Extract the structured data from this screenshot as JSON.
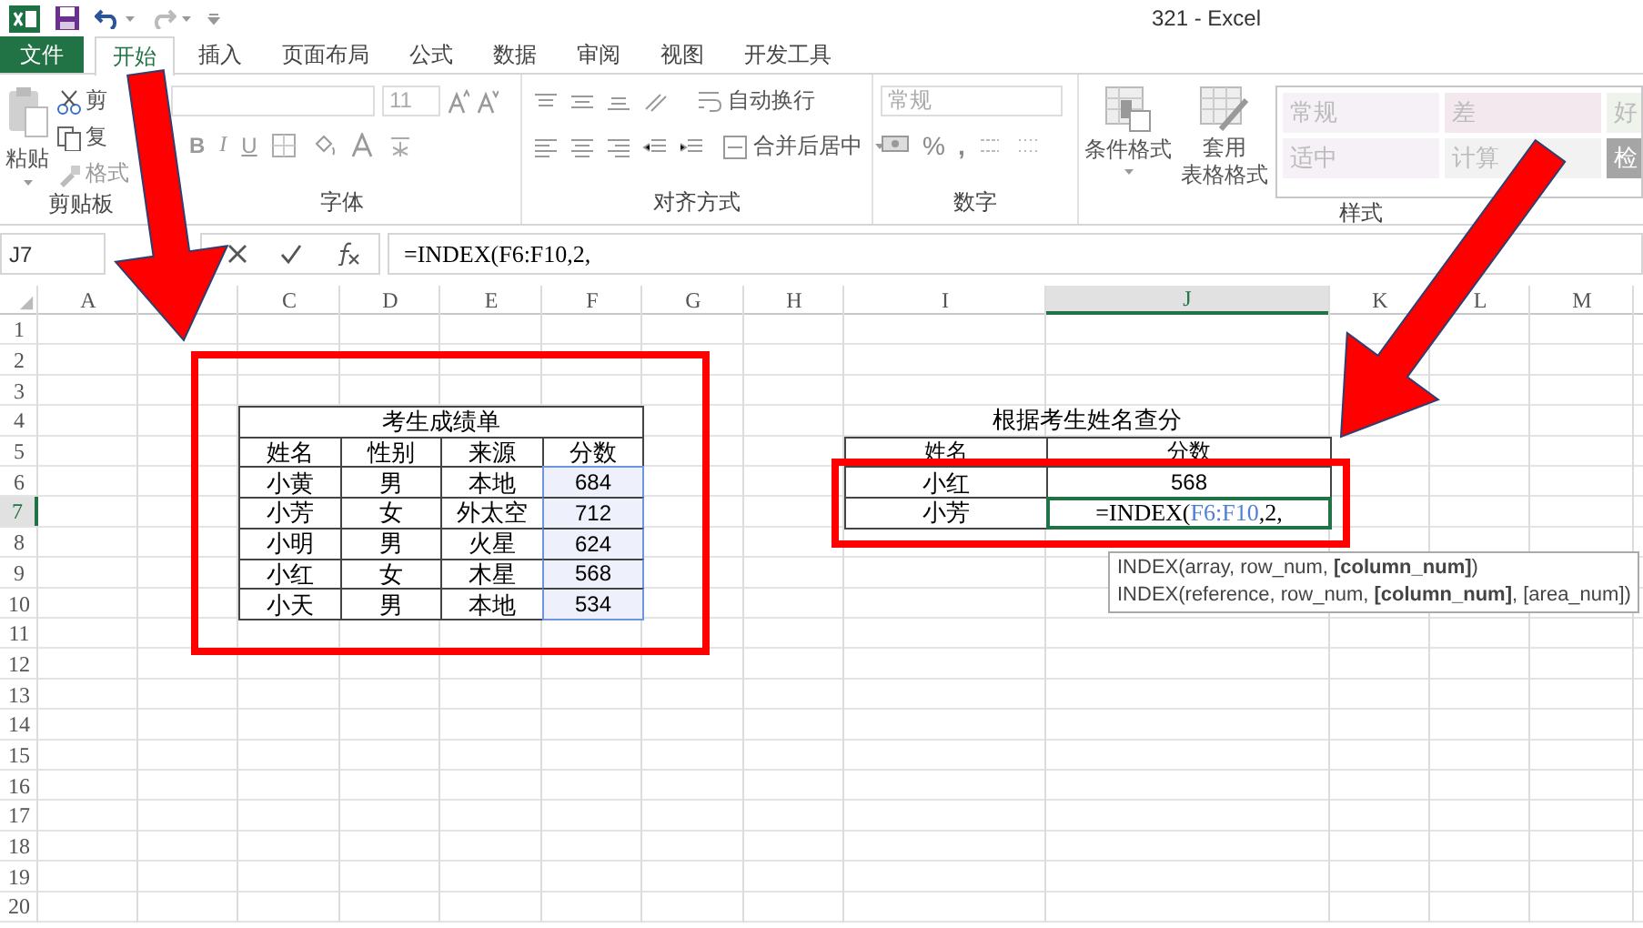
{
  "title_bar": {
    "title": "321 - Excel"
  },
  "tabs": [
    {
      "label": "文件",
      "kind": "file",
      "selected": false
    },
    {
      "label": "开始",
      "kind": "tab",
      "selected": true
    },
    {
      "label": "插入",
      "kind": "tab",
      "selected": false
    },
    {
      "label": "页面布局",
      "kind": "tab",
      "selected": false
    },
    {
      "label": "公式",
      "kind": "tab",
      "selected": false
    },
    {
      "label": "数据",
      "kind": "tab",
      "selected": false
    },
    {
      "label": "审阅",
      "kind": "tab",
      "selected": false
    },
    {
      "label": "视图",
      "kind": "tab",
      "selected": false
    },
    {
      "label": "开发工具",
      "kind": "tab",
      "selected": false
    }
  ],
  "ribbon": {
    "groups": [
      {
        "kind": "clipboard",
        "label": "剪贴板",
        "paste": "粘贴",
        "cut": "剪",
        "copy": "复",
        "format_painter": "格式"
      },
      {
        "kind": "font",
        "label": "字体",
        "font_size": "11",
        "bold": "B",
        "italic": "I",
        "underline": "U"
      },
      {
        "kind": "alignment",
        "label": "对齐方式",
        "wrap_text": "自动换行",
        "merge_center": "合并后居中"
      },
      {
        "kind": "number",
        "label": "数字",
        "format": "常规",
        "percent": "%",
        "comma": ","
      },
      {
        "kind": "styles",
        "label": "样式",
        "conditional": "条件格式",
        "format_table": [
          "套用",
          "表格格式"
        ],
        "cell_styles": [
          {
            "label": "常规",
            "color": "#f6f1f6"
          },
          {
            "label": "差",
            "color": "#f2e8ee"
          },
          {
            "label": "好",
            "color": "#eef3ec"
          },
          {
            "label": "适中",
            "color": "#f6f1f6"
          },
          {
            "label": "计算",
            "color": "#f2f2f2"
          },
          {
            "label": "检",
            "color": "#a5a5a5"
          }
        ]
      }
    ]
  },
  "formula_bar": {
    "name_box": "J7",
    "formula": "=INDEX(F6:F10,2,"
  },
  "sheet": {
    "columns": [
      {
        "label": "A",
        "selected": false
      },
      {
        "label": "C",
        "selected": false
      },
      {
        "label": "D",
        "selected": false
      },
      {
        "label": "E",
        "selected": false
      },
      {
        "label": "F",
        "selected": false
      },
      {
        "label": "G",
        "selected": false
      },
      {
        "label": "H",
        "selected": false
      },
      {
        "label": "I",
        "selected": false
      },
      {
        "label": "J",
        "selected": true
      },
      {
        "label": "K",
        "selected": false
      },
      {
        "label": "L",
        "selected": false
      },
      {
        "label": "M",
        "selected": false
      }
    ],
    "rows": [
      {
        "label": "1",
        "selected": false
      },
      {
        "label": "2",
        "selected": false
      },
      {
        "label": "3",
        "selected": false
      },
      {
        "label": "4",
        "selected": false
      },
      {
        "label": "5",
        "selected": false
      },
      {
        "label": "6",
        "selected": false
      },
      {
        "label": "7",
        "selected": true
      },
      {
        "label": "8",
        "selected": false
      },
      {
        "label": "9",
        "selected": false
      },
      {
        "label": "10",
        "selected": false
      },
      {
        "label": "11",
        "selected": false
      },
      {
        "label": "12",
        "selected": false
      },
      {
        "label": "13",
        "selected": false
      },
      {
        "label": "14",
        "selected": false
      },
      {
        "label": "15",
        "selected": false
      },
      {
        "label": "16",
        "selected": false
      },
      {
        "label": "17",
        "selected": false
      },
      {
        "label": "18",
        "selected": false
      },
      {
        "label": "19",
        "selected": false
      },
      {
        "label": "20",
        "selected": false
      }
    ],
    "score_table": {
      "title": "考生成绩单",
      "columns": [
        {
          "label": "姓名",
          "highlighted": false
        },
        {
          "label": "性别",
          "highlighted": false
        },
        {
          "label": "来源",
          "highlighted": false
        },
        {
          "label": "分数",
          "highlighted": true
        }
      ],
      "rows": [
        [
          "小黄",
          "男",
          "本地",
          "684"
        ],
        [
          "小芳",
          "女",
          "外太空",
          "712"
        ],
        [
          "小明",
          "男",
          "火星",
          "624"
        ],
        [
          "小红",
          "女",
          "木星",
          "568"
        ],
        [
          "小天",
          "男",
          "本地",
          "534"
        ]
      ]
    },
    "lookup_table": {
      "title": "根据考生姓名查分",
      "columns": [
        "姓名",
        "分数"
      ],
      "rows": [
        {
          "name": "小红",
          "editing": false,
          "score": [
            {
              "text": "568",
              "kind": "number"
            }
          ]
        },
        {
          "name": "小芳",
          "editing": true,
          "score": [
            {
              "text": "=INDEX(",
              "kind": "plain"
            },
            {
              "text": "F6:F10",
              "kind": "reference"
            },
            {
              "text": ",2,",
              "kind": "plain"
            }
          ]
        }
      ]
    },
    "tooltip": {
      "lines": [
        "INDEX(array, row_num, **[column_num]**)",
        "INDEX(reference, row_num, **[column_num]**, [area_num])"
      ]
    }
  },
  "annotations": [
    {
      "kind": "arrow"
    },
    {
      "kind": "arrow"
    },
    {
      "kind": "box"
    },
    {
      "kind": "box"
    }
  ]
}
